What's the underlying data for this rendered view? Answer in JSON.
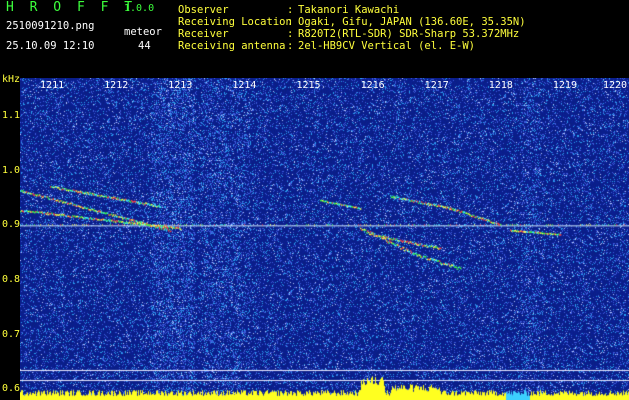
{
  "header": {
    "app_title": "H R O F F T",
    "app_version": "1.0.0",
    "file_name": "2510091210.png",
    "mode_label": "meteor",
    "datetime": "25.10.09 12:10",
    "count": "44"
  },
  "info": [
    {
      "label": "Observer",
      "value": "Takanori Kawachi"
    },
    {
      "label": "Receiving Location",
      "value": "Ogaki, Gifu, JAPAN (136.60E, 35.35N)"
    },
    {
      "label": "Receiver",
      "value": "R820T2(RTL-SDR) SDR-Sharp 53.372MHz"
    },
    {
      "label": "Receiving antenna",
      "value": "2el-HB9CV Vertical (el. E-W)"
    }
  ],
  "chart_data": {
    "type": "heatmap",
    "ylabel": "kHz",
    "x_ticks": [
      "1211",
      "1212",
      "1213",
      "1214",
      "1215",
      "1216",
      "1217",
      "1218",
      "1219",
      "1220"
    ],
    "y_ticks": [
      "1.1",
      "1.0",
      "0.9",
      "0.8",
      "0.7",
      "0.6"
    ],
    "ylim": [
      0.58,
      1.17
    ],
    "xlim": [
      1210.5,
      1220
    ]
  },
  "colors": {
    "background": "#0a1f8a",
    "header_text_green": "#3cff3c",
    "label_text_yellow": "#ffff3c",
    "trail_colors": [
      "#ff4040",
      "#ffff40",
      "#40ff40",
      "#40ffff"
    ]
  }
}
